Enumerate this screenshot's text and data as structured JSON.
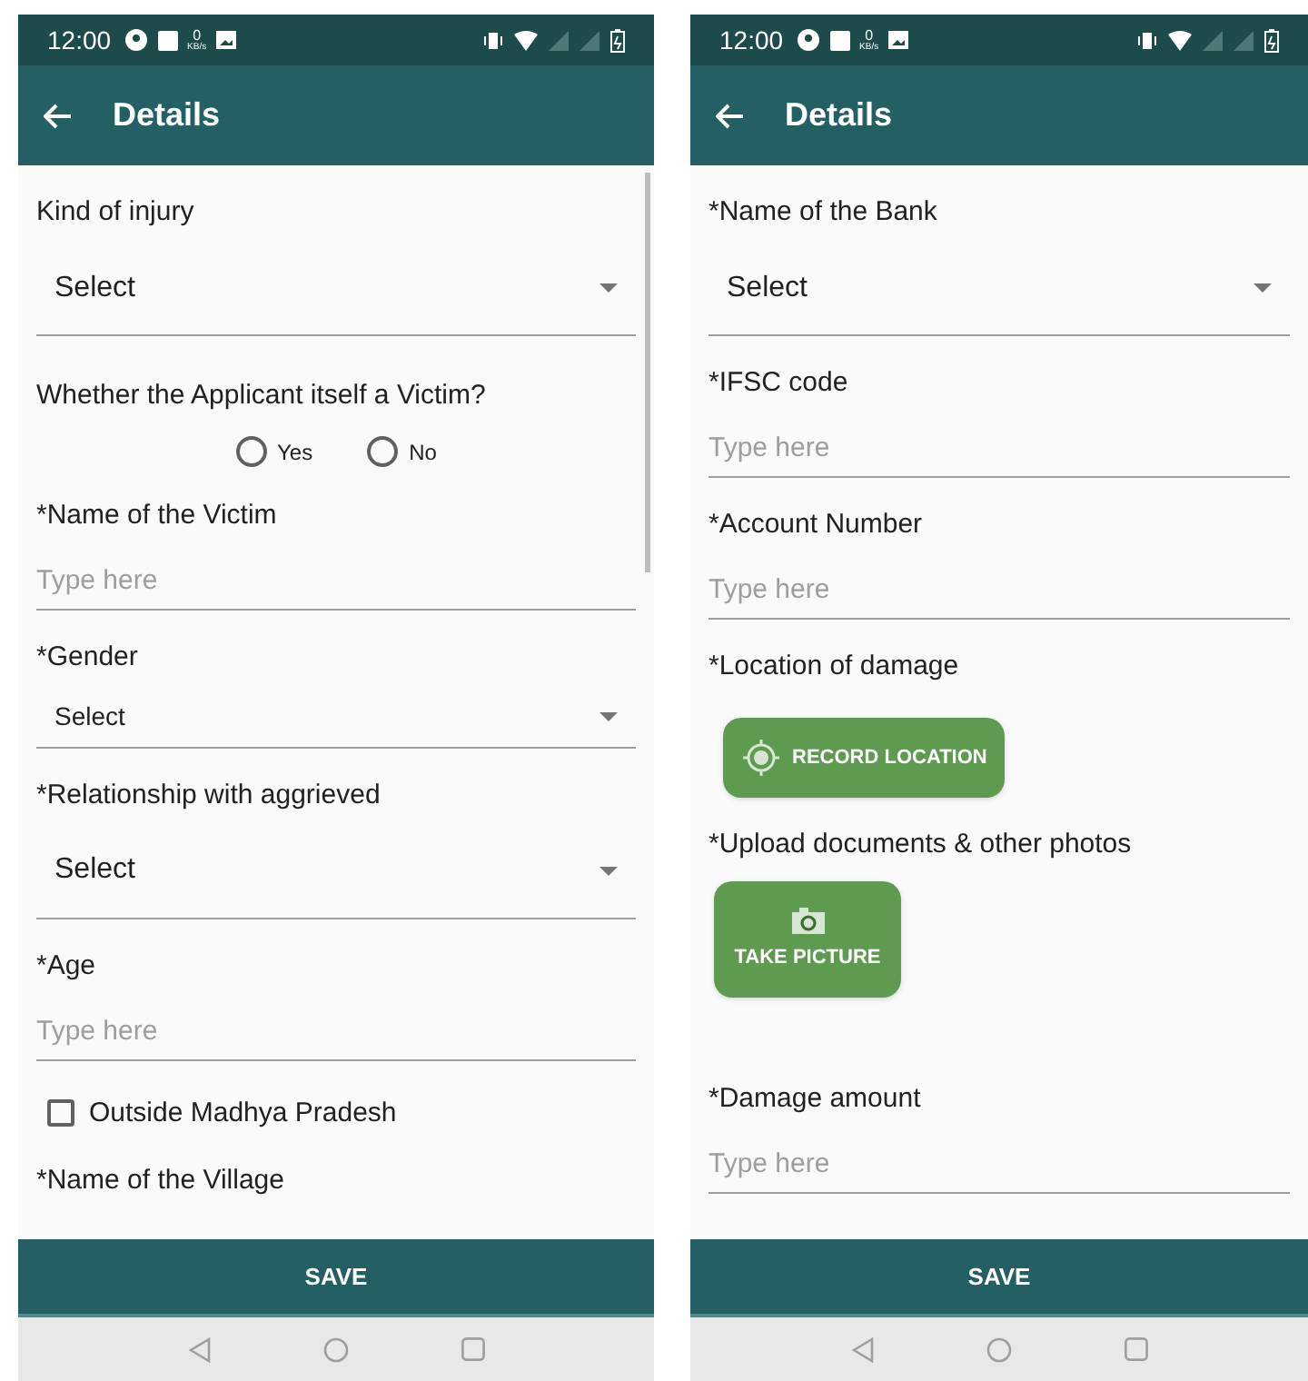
{
  "screens": [
    {
      "status_bar": {
        "time": "12:00",
        "speed_value": "0",
        "speed_unit": "KB/s"
      },
      "app_bar": {
        "title": "Details"
      },
      "fields": [
        {
          "kind": "label",
          "text": "Kind of injury"
        },
        {
          "kind": "dropdown",
          "value": "Select"
        },
        {
          "kind": "question",
          "text": "Whether the Applicant itself a Victim?",
          "options": [
            {
              "label": "Yes",
              "selected": false
            },
            {
              "label": "No",
              "selected": false
            }
          ]
        },
        {
          "kind": "label",
          "text": "*Name of the Victim"
        },
        {
          "kind": "input",
          "placeholder": "Type here"
        },
        {
          "kind": "label",
          "text": "*Gender"
        },
        {
          "kind": "compact_dropdown",
          "value": "Select"
        },
        {
          "kind": "label",
          "text": "*Relationship with aggrieved"
        },
        {
          "kind": "dropdown",
          "value": "Select"
        },
        {
          "kind": "label",
          "text": "*Age"
        },
        {
          "kind": "input",
          "placeholder": "Type here"
        },
        {
          "kind": "checkbox",
          "label": "Outside Madhya Pradesh",
          "checked": false
        },
        {
          "kind": "label",
          "text": "*Name of the Village"
        }
      ],
      "save": "SAVE"
    },
    {
      "status_bar": {
        "time": "12:00",
        "speed_value": "0",
        "speed_unit": "KB/s"
      },
      "app_bar": {
        "title": "Details"
      },
      "fields": [
        {
          "kind": "label",
          "text": "*Name of the Bank"
        },
        {
          "kind": "dropdown",
          "value": "Select"
        },
        {
          "kind": "label",
          "text": "*IFSC code"
        },
        {
          "kind": "input",
          "placeholder": "Type here"
        },
        {
          "kind": "label",
          "text": "*Account Number"
        },
        {
          "kind": "input",
          "placeholder": "Type here"
        },
        {
          "kind": "label",
          "text": "*Location of damage"
        },
        {
          "kind": "location_button",
          "label": "RECORD LOCATION"
        },
        {
          "kind": "label",
          "text": "*Upload documents & other photos"
        },
        {
          "kind": "camera_button",
          "label": "TAKE PICTURE"
        },
        {
          "kind": "label",
          "text": "*Damage amount"
        },
        {
          "kind": "input",
          "placeholder": "Type here"
        }
      ],
      "save": "SAVE"
    }
  ]
}
